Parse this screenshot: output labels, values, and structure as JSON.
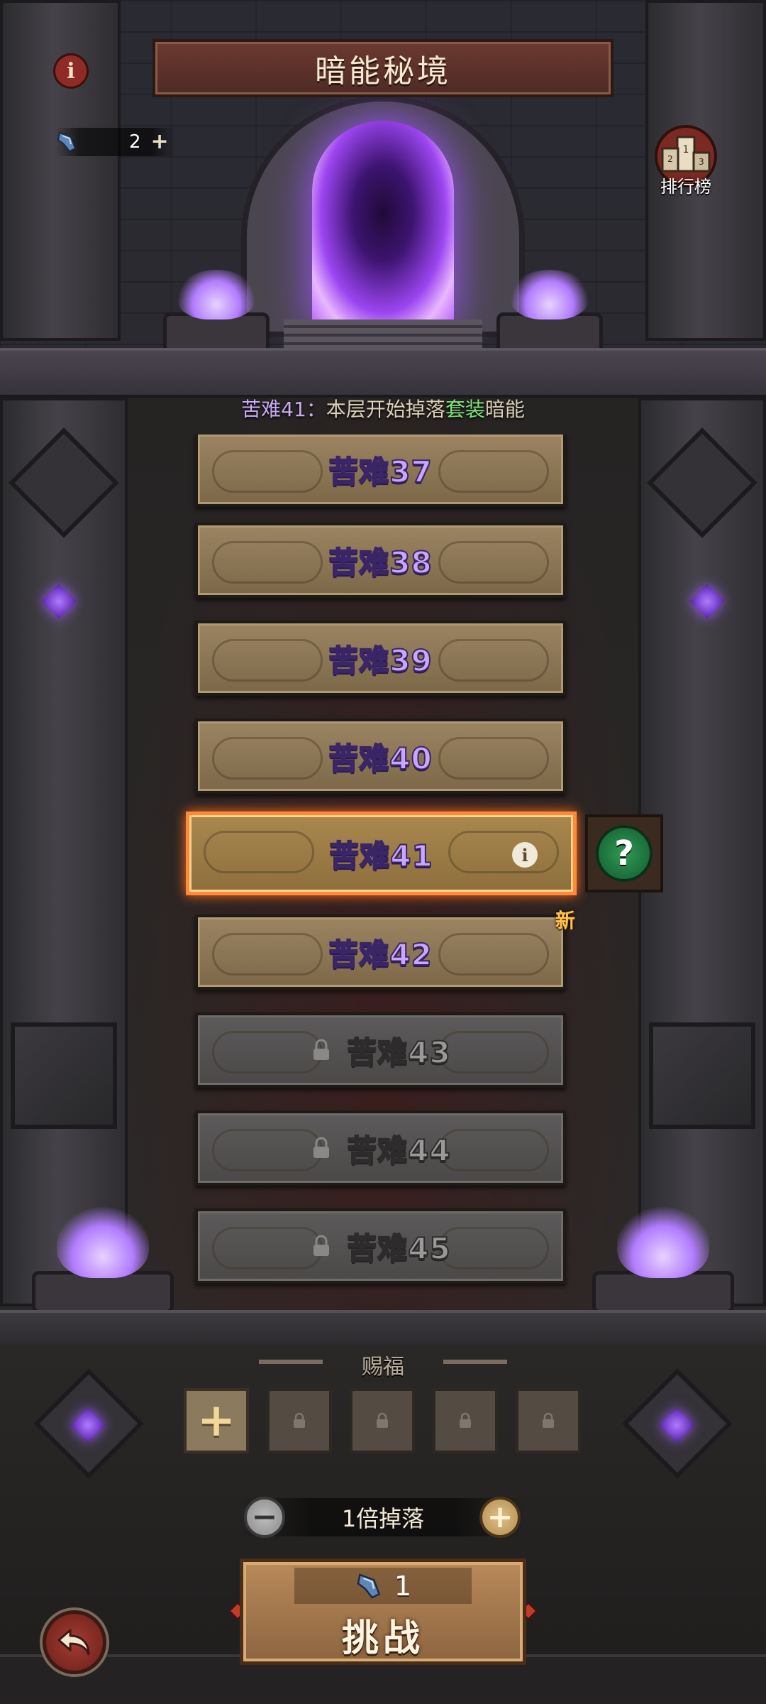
{
  "header": {
    "title": "暗能秘境",
    "info_icon": "info-icon",
    "currency": {
      "icon": "key-icon",
      "value": "2",
      "add_icon": "plus-icon"
    },
    "ranking": {
      "icon": "podium-icon",
      "label": "排行榜"
    }
  },
  "hint": {
    "part1": "苦难41：",
    "part2": "本层开始掉落",
    "part3": "套装",
    "part4": "暗能",
    "highlight_color": "#7ee37a"
  },
  "levels": [
    {
      "label": "苦难37",
      "state": "unlocked"
    },
    {
      "label": "苦难38",
      "state": "unlocked"
    },
    {
      "label": "苦难39",
      "state": "unlocked"
    },
    {
      "label": "苦难40",
      "state": "unlocked"
    },
    {
      "label": "苦难41",
      "state": "selected"
    },
    {
      "label": "苦难42",
      "state": "unlocked"
    },
    {
      "label": "苦难43",
      "state": "locked"
    },
    {
      "label": "苦难44",
      "state": "locked"
    },
    {
      "label": "苦难45",
      "state": "locked"
    }
  ],
  "mystery": {
    "icon": "question-mark-icon",
    "symbol": "?"
  },
  "new_tag": "新",
  "blessing": {
    "title": "赐福",
    "slots": [
      "add",
      "locked",
      "locked",
      "locked",
      "locked"
    ],
    "add_symbol": "+"
  },
  "multiplier": {
    "label": "1倍掉落",
    "minus_symbol": "−",
    "plus_symbol": "+"
  },
  "challenge": {
    "cost": "1",
    "cost_icon": "key-icon",
    "label": "挑战"
  },
  "back": {
    "icon": "back-arrow-icon"
  },
  "colors": {
    "accent_purple": "#c9a6ff",
    "selected_border": "#ff8a3a",
    "portal": "#9c45f0"
  }
}
